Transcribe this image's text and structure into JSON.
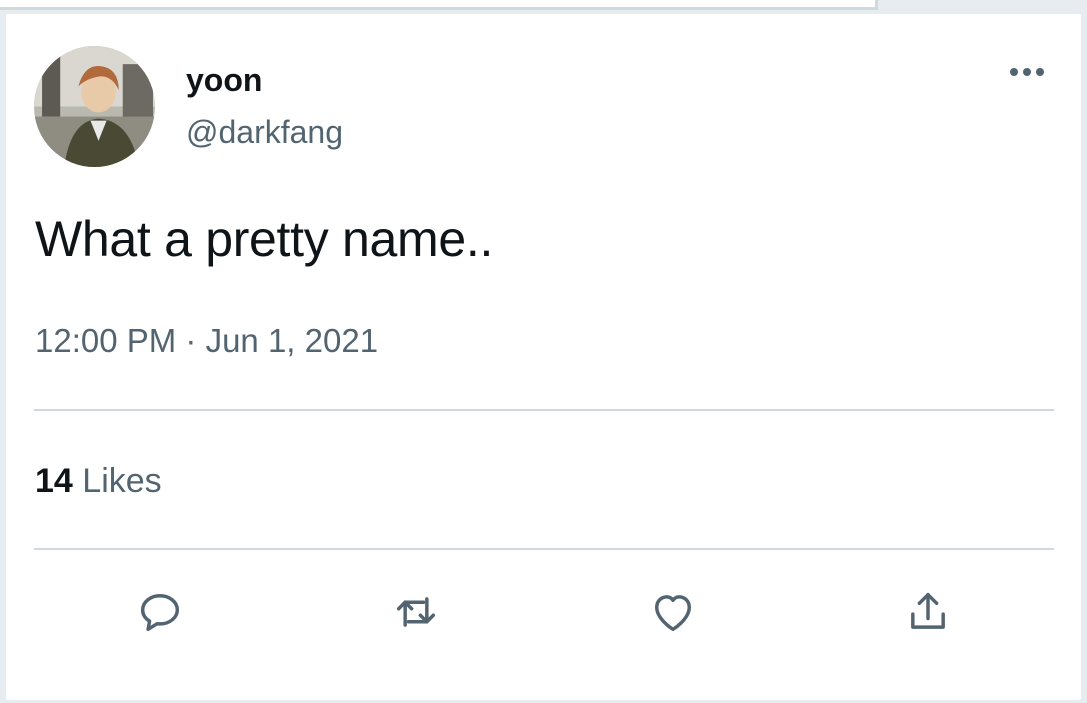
{
  "user": {
    "display_name": "yoon",
    "handle": "@darkfang",
    "avatar_icon": "user-avatar-photo"
  },
  "tweet": {
    "text": "What a pretty name..",
    "timestamp": "12:00 PM · Jun 1, 2021"
  },
  "stats": {
    "likes_count": "14",
    "likes_label": "Likes"
  },
  "actions": [
    {
      "name": "reply",
      "icon": "reply-icon"
    },
    {
      "name": "retweet",
      "icon": "retweet-icon"
    },
    {
      "name": "like",
      "icon": "heart-icon"
    },
    {
      "name": "share",
      "icon": "share-icon"
    }
  ],
  "colors": {
    "primary_text": "#0f1419",
    "secondary_text": "#536471",
    "divider": "#cfd9de",
    "background": "#ffffff"
  }
}
